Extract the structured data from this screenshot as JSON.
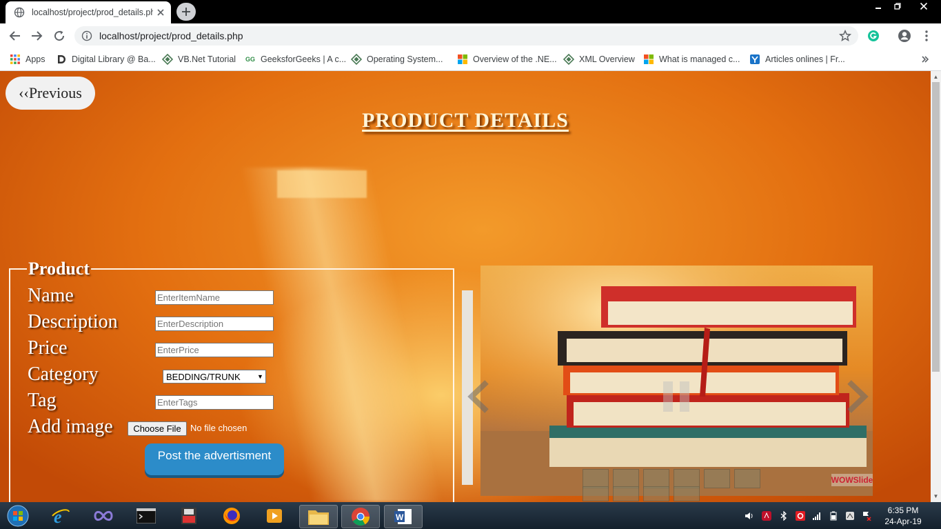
{
  "browser": {
    "tab_title": "localhost/project/prod_details.php",
    "url": "localhost/project/prod_details.php",
    "bookmarks": [
      "Apps",
      "Digital Library @ Ba...",
      "VB.Net Tutorial",
      "GeeksforGeeks | A c...",
      "Operating System...",
      "Overview of the .NE...",
      "XML Overview",
      "What is managed c...",
      "Articles onlines | Fr..."
    ]
  },
  "page": {
    "prev_label": "‹‹Previous",
    "title": "PRODUCT DETAILS",
    "legend": "Product",
    "fields": {
      "name_label": "Name",
      "name_placeholder": "EnterItemName",
      "description_label": "Description",
      "description_placeholder": "EnterDescription",
      "price_label": "Price",
      "price_placeholder": "EnterPrice",
      "category_label": "Category",
      "category_value": "BEDDING/TRUNK",
      "tag_label": "Tag",
      "tag_placeholder": "EnterTags",
      "image_label": "Add image",
      "file_button": "Choose File",
      "file_status": "No file chosen"
    },
    "post_label": "Post the advertisment",
    "slider_watermark": "WOWSlide"
  },
  "taskbar": {
    "time": "6:35 PM",
    "date": "24-Apr-19"
  },
  "colors": {
    "accent_button": "#2c8cc9",
    "page_orange": "#e36f10"
  }
}
